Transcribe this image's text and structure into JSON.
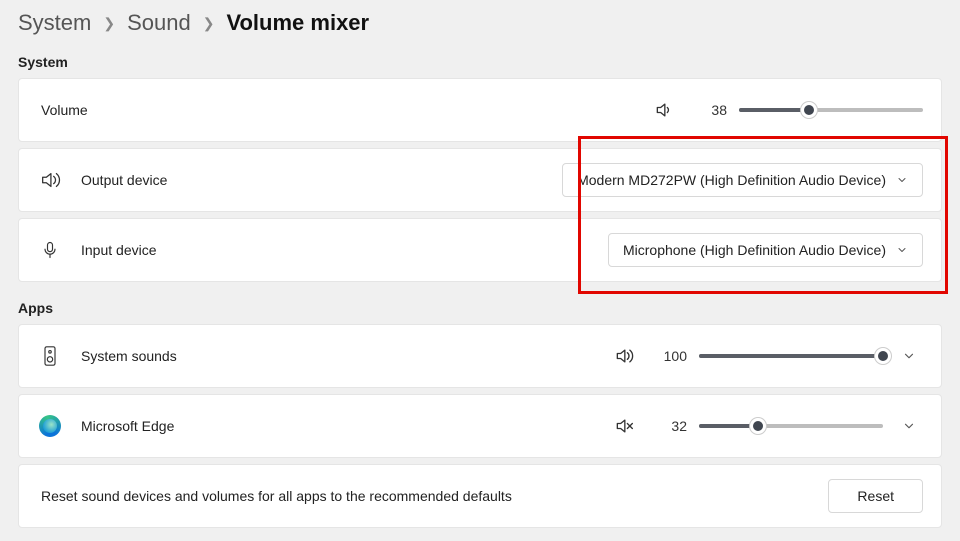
{
  "breadcrumb": {
    "l0": "System",
    "l1": "Sound",
    "current": "Volume mixer"
  },
  "sections": {
    "system": "System",
    "apps": "Apps"
  },
  "volume": {
    "label": "Volume",
    "value": "38",
    "percent": 38
  },
  "outputDevice": {
    "label": "Output device",
    "selected": "Modern MD272PW (High Definition Audio Device)"
  },
  "inputDevice": {
    "label": "Input device",
    "selected": "Microphone (High Definition Audio Device)"
  },
  "appSystemSounds": {
    "label": "System sounds",
    "value": "100",
    "percent": 100
  },
  "appEdge": {
    "label": "Microsoft Edge",
    "value": "32",
    "percent": 32,
    "muted": true
  },
  "reset": {
    "text": "Reset sound devices and volumes for all apps to the recommended defaults",
    "button": "Reset"
  }
}
